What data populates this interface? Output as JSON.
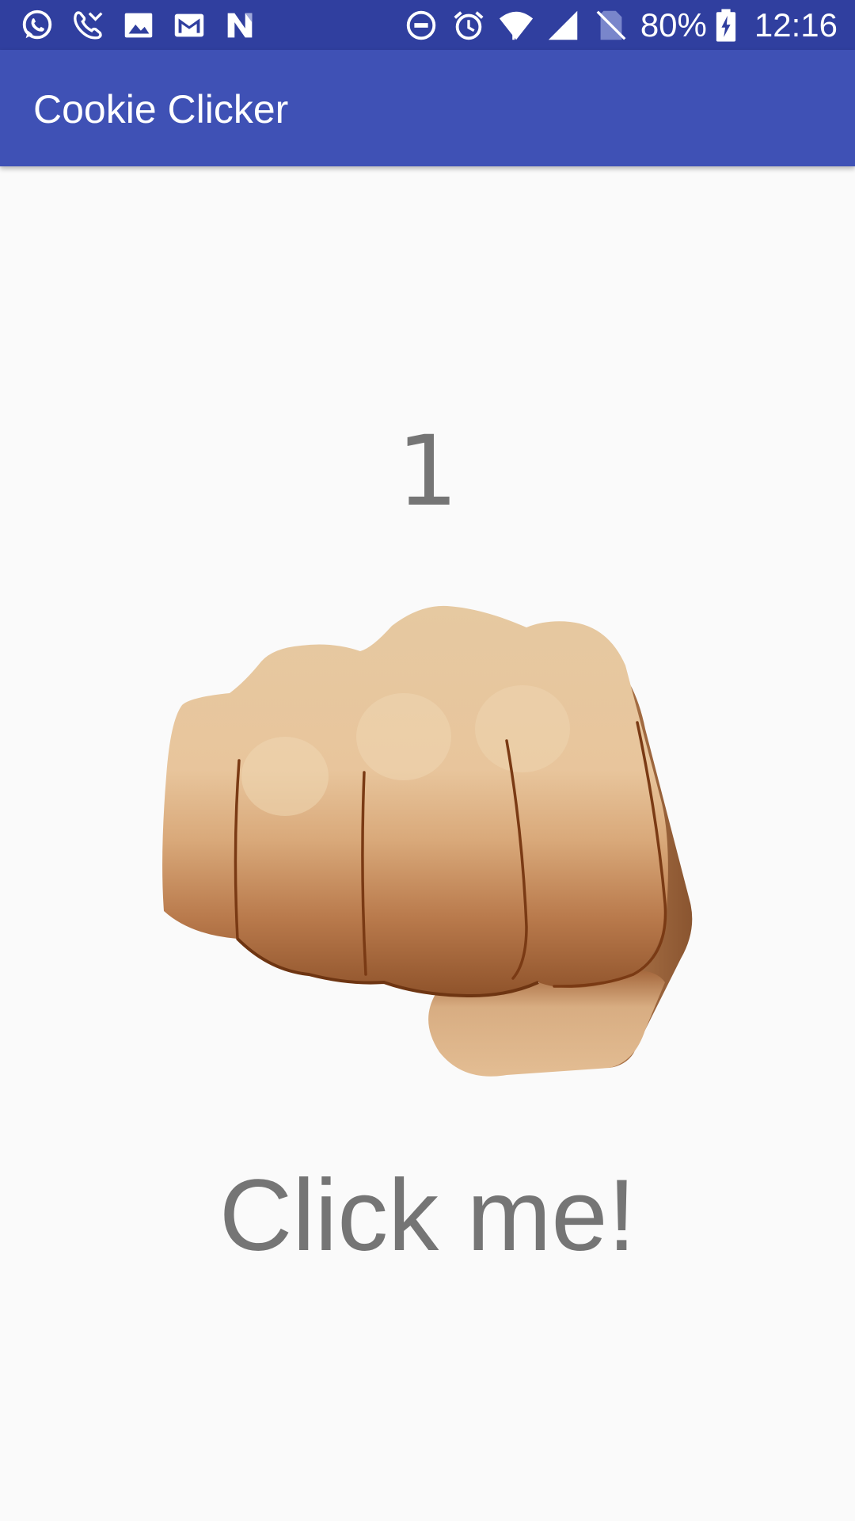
{
  "status_bar": {
    "notification_icons": [
      "whatsapp-icon",
      "missed-call-icon",
      "image-icon",
      "gmail-icon",
      "n-icon"
    ],
    "system_icons": [
      "do-not-disturb-icon",
      "alarm-icon",
      "wifi-icon",
      "cell-signal-icon",
      "no-sim-icon",
      "battery-charging-icon"
    ],
    "battery": "80%",
    "time": "12:16",
    "background": "#303f9f"
  },
  "app_bar": {
    "title": "Cookie Clicker",
    "background": "#3f51b5"
  },
  "main": {
    "count": "1",
    "click_icon": "oncoming-fist-icon",
    "click_label": "Click me!",
    "text_color": "#757575",
    "background": "#fafafa"
  }
}
